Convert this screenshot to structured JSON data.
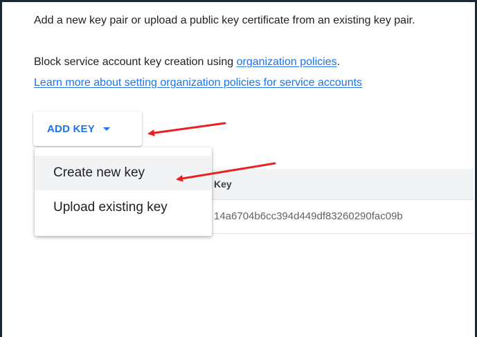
{
  "intro_text": "Add a new key pair or upload a public key certificate from an existing key pair.",
  "policy": {
    "prefix": "Block service account key creation using ",
    "link": "organization policies",
    "suffix": "."
  },
  "learn_more_link": "Learn more about setting organization policies for service accounts",
  "add_key_button": {
    "label": "ADD KEY",
    "icon": "caret-down-icon"
  },
  "dropdown": {
    "items": [
      {
        "label": "Create new key"
      },
      {
        "label": "Upload existing key"
      }
    ]
  },
  "keys_table": {
    "columns": [
      "Key"
    ],
    "rows": [
      {
        "key_id": "14a6704b6cc394d449df83260290fac09b"
      }
    ]
  },
  "annotation_color": "#e8201f",
  "accent_color": "#1a73e8"
}
